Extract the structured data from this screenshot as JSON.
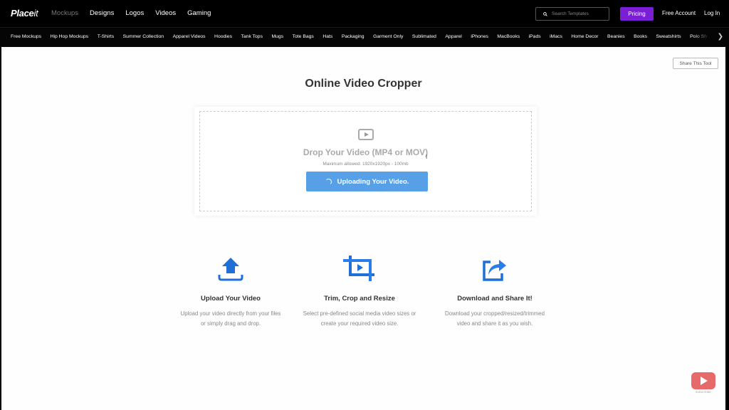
{
  "header": {
    "logo_bold": "Place",
    "logo_light": "it",
    "nav": [
      "Mockups",
      "Designs",
      "Logos",
      "Videos",
      "Gaming"
    ],
    "search_placeholder": "Search Templates",
    "pricing_label": "Pricing",
    "free_account_label": "Free Account",
    "login_label": "Log In"
  },
  "categories": [
    "Free Mockups",
    "Hip Hop Mockups",
    "T-Shirts",
    "Summer Collection",
    "Apparel Videos",
    "Hoodies",
    "Tank Tops",
    "Mugs",
    "Tote Bags",
    "Hats",
    "Packaging",
    "Garment Only",
    "Sublimated",
    "Apparel",
    "iPhones",
    "MacBooks",
    "iPads",
    "iMacs",
    "Home Decor",
    "Beanies",
    "Books",
    "Sweatshirts",
    "Polo Sh"
  ],
  "colors": {
    "accent": "#7a1fd6",
    "upload_button": "#57a0e8",
    "icon_blue": "#1f6fd6"
  },
  "page": {
    "share_label": "Share This Tool",
    "title": "Online Video Cropper",
    "drop_title": "Drop Your Video (MP4 or MOV)",
    "max_allowed": "Maximum allowed: 1920x1920px - 100mb",
    "upload_status": "Uploading Your Video."
  },
  "features": [
    {
      "title": "Upload Your Video",
      "line1": "Upload your video directly from your files",
      "line2": "or simply drag and drop."
    },
    {
      "title": "Trim, Crop and Resize",
      "line1": "Select pre-defined social media video sizes or",
      "line2": "create your required video size."
    },
    {
      "title": "Download and Share It!",
      "line1": "Download your cropped/resized/trimmed",
      "line2": "video and share it as you wish."
    }
  ],
  "badge": {
    "label": "SUBSCRIBE"
  }
}
